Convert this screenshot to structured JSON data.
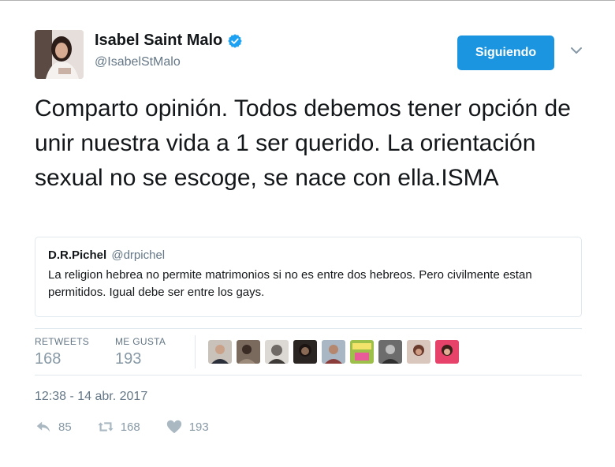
{
  "author": {
    "display_name": "Isabel Saint Malo",
    "handle": "@IsabelStMalo",
    "verified": true
  },
  "follow_button": {
    "label": "Siguiendo",
    "color": "#1b95e0"
  },
  "tweet": {
    "text": "Comparto opinión. Todos debemos tener opción de unir nuestra vida a 1 ser querido. La orientación sexual no se escoge, se nace con ella.ISMA"
  },
  "quoted_tweet": {
    "name": "D.R.Pichel",
    "handle": "@drpichel",
    "text": "La religion hebrea no permite matrimonios si no es entre dos hebreos. Pero civilmente estan permitidos. Igual debe ser entre los gays."
  },
  "stats": {
    "retweets_label": "RETWEETS",
    "retweets_value": "168",
    "likes_label": "ME GUSTA",
    "likes_value": "193",
    "liker_avatar_count": 9
  },
  "timestamp": "12:38 - 14 abr. 2017",
  "actions": {
    "reply_count": "85",
    "retweet_count": "168",
    "like_count": "193"
  },
  "icons": [
    "verified-badge-icon",
    "chevron-down-icon",
    "reply-icon",
    "retweet-icon",
    "heart-icon"
  ]
}
